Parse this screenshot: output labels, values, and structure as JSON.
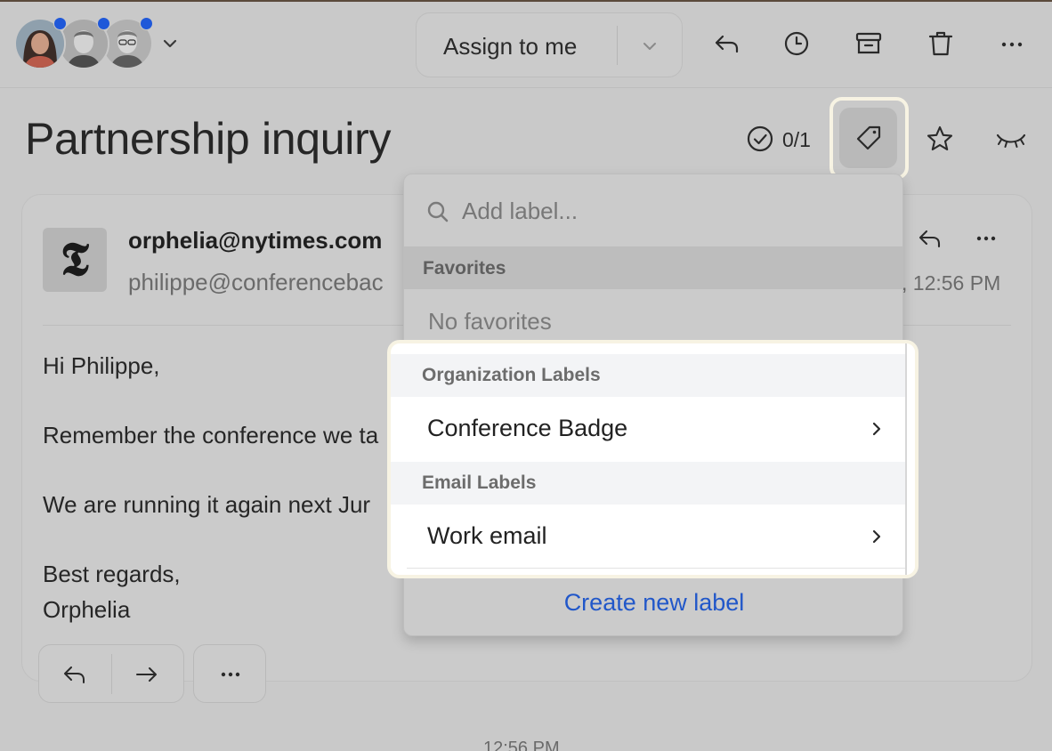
{
  "header": {
    "participants": [
      "participant-woman",
      "participant-man-1",
      "participant-man-2"
    ],
    "assign_label": "Assign to me",
    "actions": [
      "reply-icon",
      "snooze-icon",
      "archive-icon",
      "trash-icon",
      "more-icon"
    ]
  },
  "conversation": {
    "title": "Partnership inquiry",
    "task_count": "0/1"
  },
  "email": {
    "from": "orphelia@nytimes.com",
    "to": "philippe@conferencebac",
    "time": ", 12:56 PM",
    "body": [
      "Hi Philippe,",
      "Remember the conference we ta",
      "We are running it again next Jur",
      "Best regards,",
      "Orphelia"
    ],
    "thread_time": "12:56 PM"
  },
  "label_menu": {
    "search_placeholder": "Add label...",
    "favorites_header": "Favorites",
    "favorites_empty": "No favorites",
    "organization_header": "Organization Labels",
    "organization_items": [
      "Conference Badge"
    ],
    "email_header": "Email Labels",
    "email_items": [
      "Work email"
    ],
    "create_label": "Create new label"
  },
  "colors": {
    "accent": "#2157c9",
    "unread_dot": "#1f58d9",
    "highlight_ring": "#f7f3e3",
    "dim_overlay": "#c9c9c9"
  }
}
